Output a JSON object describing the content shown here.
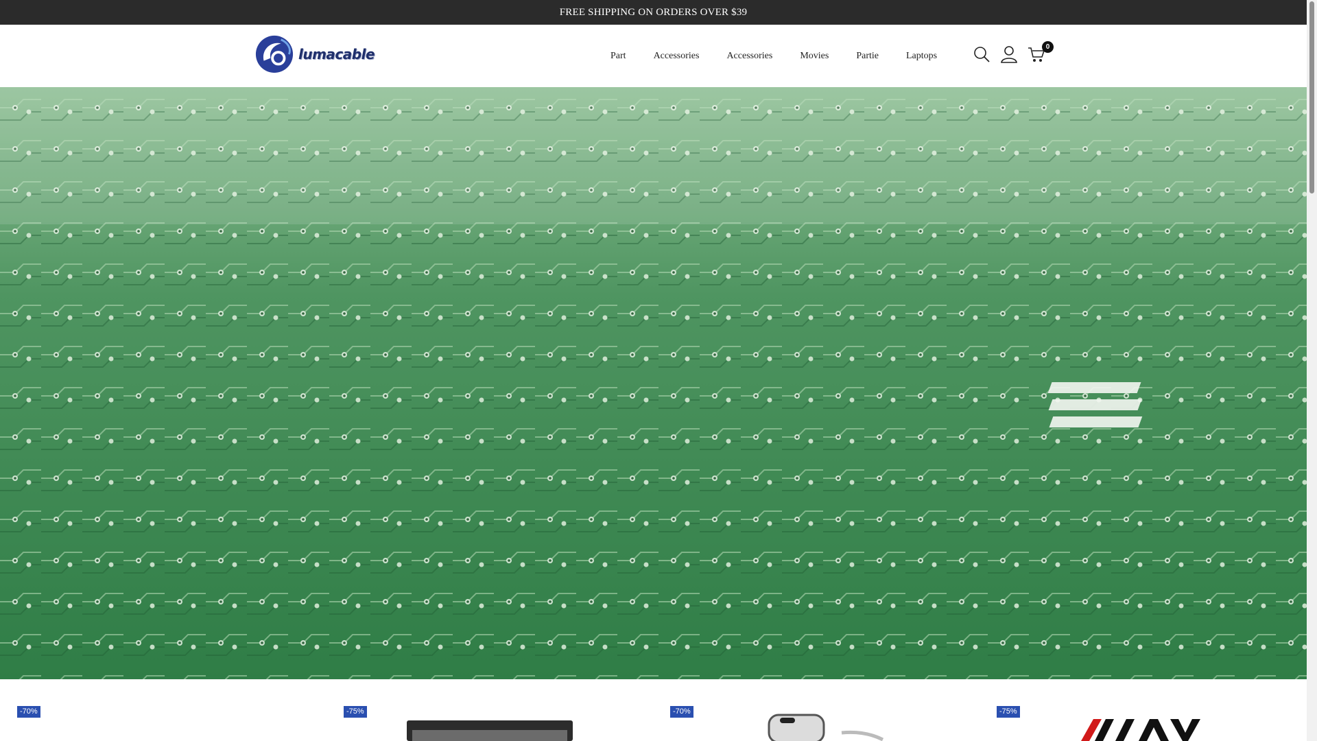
{
  "announcement": "FREE SHIPPING ON ORDERS OVER $39",
  "brand": {
    "name": "lumacable"
  },
  "nav": [
    "Part",
    "Accessories",
    "Accessories",
    "Movies",
    "Partie",
    "Laptops"
  ],
  "header_icons": {
    "search": "search-icon",
    "account": "user-icon",
    "cart": "cart-icon"
  },
  "cart_count": "0",
  "hero": {
    "image": "green circuit board",
    "color": "#4e8f5b"
  },
  "products": [
    {
      "discount": "-70%"
    },
    {
      "discount": "-75%"
    },
    {
      "discount": "-70%"
    },
    {
      "discount": "-75%"
    }
  ],
  "colors": {
    "announcement_bg": "#2b2b2b",
    "badge": "#2a4fb0",
    "brand": "#1f2f6b"
  }
}
